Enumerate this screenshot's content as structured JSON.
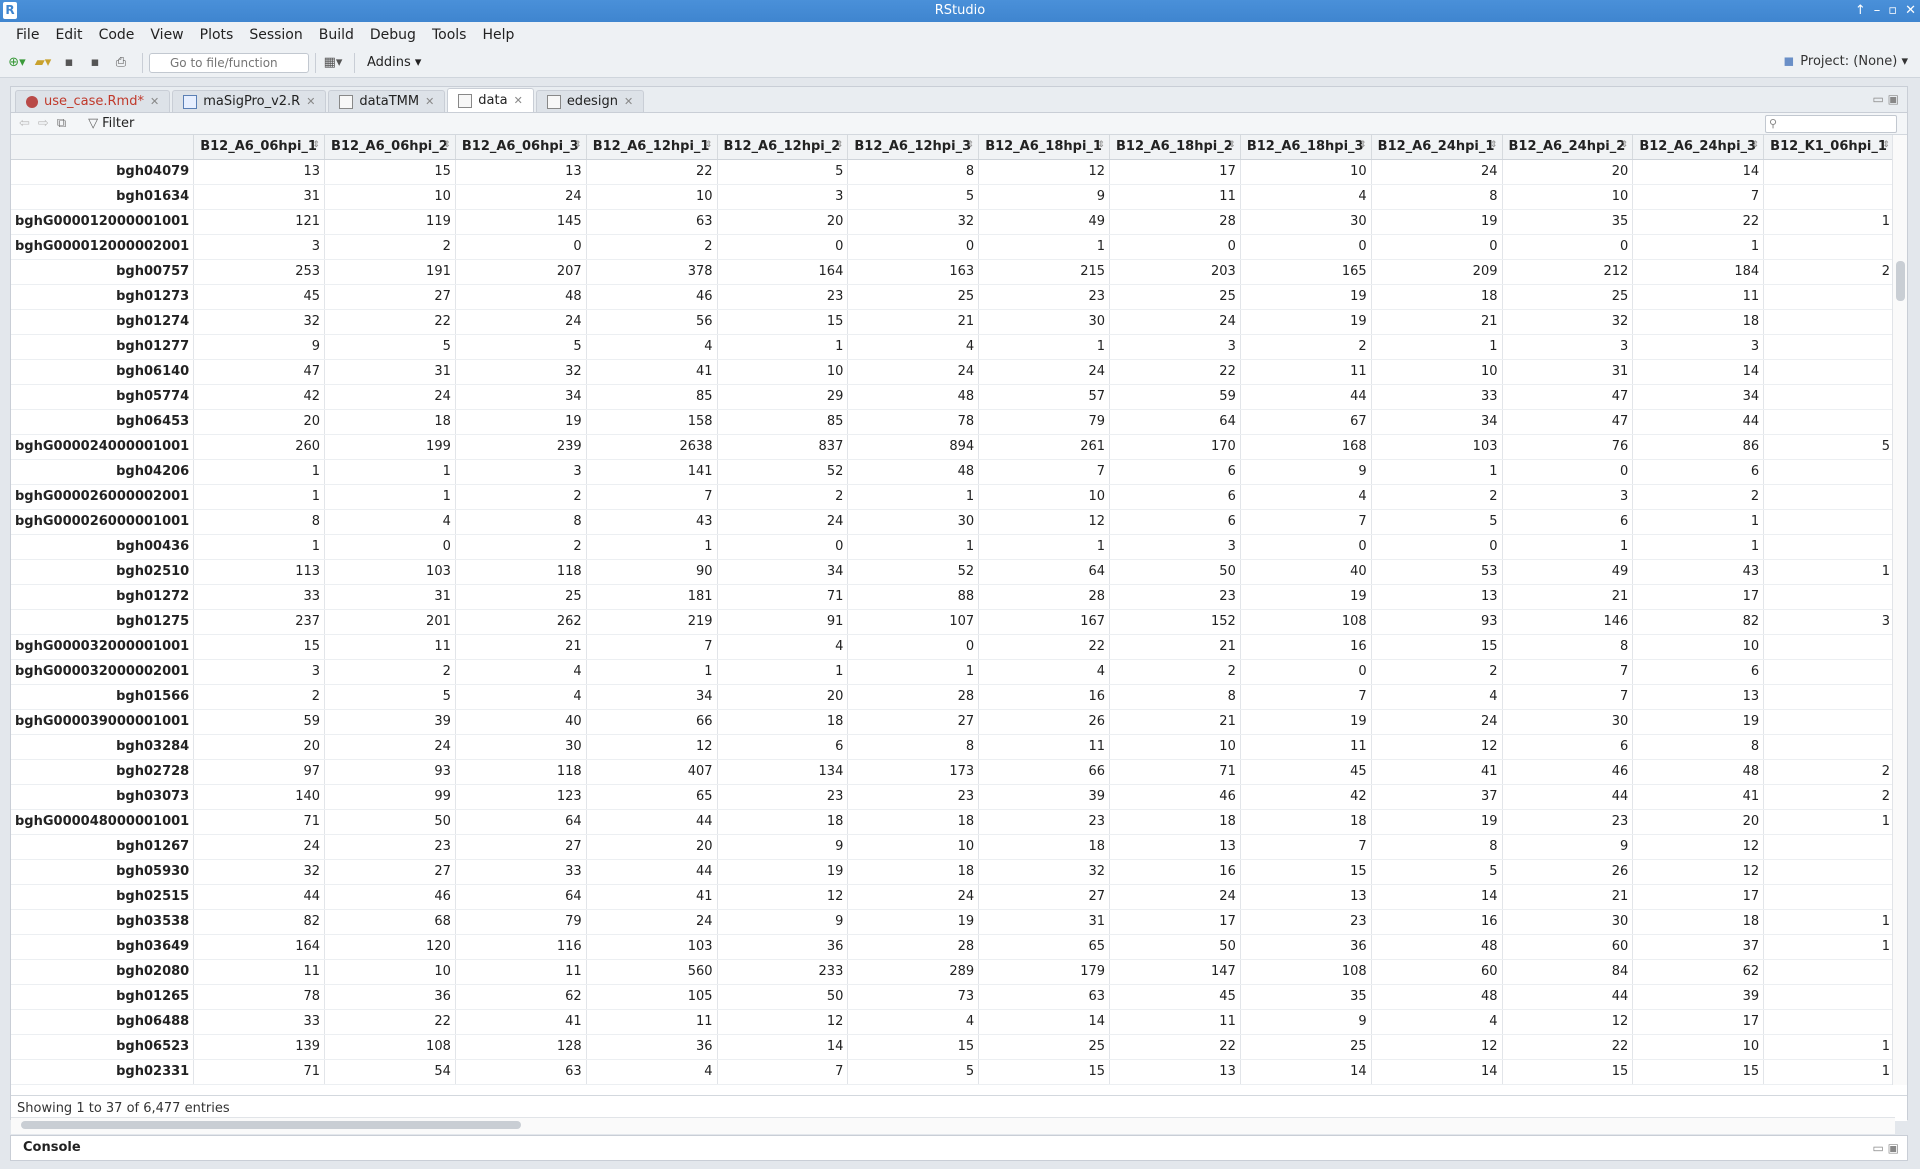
{
  "window": {
    "title": "RStudio"
  },
  "menu": [
    "File",
    "Edit",
    "Code",
    "View",
    "Plots",
    "Session",
    "Build",
    "Debug",
    "Tools",
    "Help"
  ],
  "toolbar": {
    "goto_placeholder": "Go to file/function",
    "addins_label": "Addins ▾",
    "project_label": "Project: (None) ▾"
  },
  "tabs": [
    {
      "label": "use_case.Rmd*",
      "kind": "rmd",
      "modified": true
    },
    {
      "label": "maSigPro_v2.R",
      "kind": "rscript"
    },
    {
      "label": "dataTMM",
      "kind": "data"
    },
    {
      "label": "data",
      "kind": "data",
      "active": true
    },
    {
      "label": "edesign",
      "kind": "data"
    }
  ],
  "filter_label": "Filter",
  "status_text": "Showing 1 to 37 of 6,477 entries",
  "console_label": "Console",
  "table": {
    "columns": [
      "B12_A6_06hpi_1",
      "B12_A6_06hpi_2",
      "B12_A6_06hpi_3",
      "B12_A6_12hpi_1",
      "B12_A6_12hpi_2",
      "B12_A6_12hpi_3",
      "B12_A6_18hpi_1",
      "B12_A6_18hpi_2",
      "B12_A6_18hpi_3",
      "B12_A6_24hpi_1",
      "B12_A6_24hpi_2",
      "B12_A6_24hpi_3",
      "B12_K1_06hpi_1"
    ],
    "rows": [
      [
        "bgh04079",
        "13",
        "15",
        "13",
        "22",
        "5",
        "8",
        "12",
        "17",
        "10",
        "24",
        "20",
        "14",
        ""
      ],
      [
        "bgh01634",
        "31",
        "10",
        "24",
        "10",
        "3",
        "5",
        "9",
        "11",
        "4",
        "8",
        "10",
        "7",
        ""
      ],
      [
        "bghG000012000001001",
        "121",
        "119",
        "145",
        "63",
        "20",
        "32",
        "49",
        "28",
        "30",
        "19",
        "35",
        "22",
        "1"
      ],
      [
        "bghG000012000002001",
        "3",
        "2",
        "0",
        "2",
        "0",
        "0",
        "1",
        "0",
        "0",
        "0",
        "0",
        "1",
        ""
      ],
      [
        "bgh00757",
        "253",
        "191",
        "207",
        "378",
        "164",
        "163",
        "215",
        "203",
        "165",
        "209",
        "212",
        "184",
        "2"
      ],
      [
        "bgh01273",
        "45",
        "27",
        "48",
        "46",
        "23",
        "25",
        "23",
        "25",
        "19",
        "18",
        "25",
        "11",
        ""
      ],
      [
        "bgh01274",
        "32",
        "22",
        "24",
        "56",
        "15",
        "21",
        "30",
        "24",
        "19",
        "21",
        "32",
        "18",
        ""
      ],
      [
        "bgh01277",
        "9",
        "5",
        "5",
        "4",
        "1",
        "4",
        "1",
        "3",
        "2",
        "1",
        "3",
        "3",
        ""
      ],
      [
        "bgh06140",
        "47",
        "31",
        "32",
        "41",
        "10",
        "24",
        "24",
        "22",
        "11",
        "10",
        "31",
        "14",
        ""
      ],
      [
        "bgh05774",
        "42",
        "24",
        "34",
        "85",
        "29",
        "48",
        "57",
        "59",
        "44",
        "33",
        "47",
        "34",
        ""
      ],
      [
        "bgh06453",
        "20",
        "18",
        "19",
        "158",
        "85",
        "78",
        "79",
        "64",
        "67",
        "34",
        "47",
        "44",
        ""
      ],
      [
        "bghG000024000001001",
        "260",
        "199",
        "239",
        "2638",
        "837",
        "894",
        "261",
        "170",
        "168",
        "103",
        "76",
        "86",
        "5"
      ],
      [
        "bgh04206",
        "1",
        "1",
        "3",
        "141",
        "52",
        "48",
        "7",
        "6",
        "9",
        "1",
        "0",
        "6",
        ""
      ],
      [
        "bghG000026000002001",
        "1",
        "1",
        "2",
        "7",
        "2",
        "1",
        "10",
        "6",
        "4",
        "2",
        "3",
        "2",
        ""
      ],
      [
        "bghG000026000001001",
        "8",
        "4",
        "8",
        "43",
        "24",
        "30",
        "12",
        "6",
        "7",
        "5",
        "6",
        "1",
        ""
      ],
      [
        "bgh00436",
        "1",
        "0",
        "2",
        "1",
        "0",
        "1",
        "1",
        "3",
        "0",
        "0",
        "1",
        "1",
        ""
      ],
      [
        "bgh02510",
        "113",
        "103",
        "118",
        "90",
        "34",
        "52",
        "64",
        "50",
        "40",
        "53",
        "49",
        "43",
        "1"
      ],
      [
        "bgh01272",
        "33",
        "31",
        "25",
        "181",
        "71",
        "88",
        "28",
        "23",
        "19",
        "13",
        "21",
        "17",
        ""
      ],
      [
        "bgh01275",
        "237",
        "201",
        "262",
        "219",
        "91",
        "107",
        "167",
        "152",
        "108",
        "93",
        "146",
        "82",
        "3"
      ],
      [
        "bghG000032000001001",
        "15",
        "11",
        "21",
        "7",
        "4",
        "0",
        "22",
        "21",
        "16",
        "15",
        "8",
        "10",
        ""
      ],
      [
        "bghG000032000002001",
        "3",
        "2",
        "4",
        "1",
        "1",
        "1",
        "4",
        "2",
        "0",
        "2",
        "7",
        "6",
        ""
      ],
      [
        "bgh01566",
        "2",
        "5",
        "4",
        "34",
        "20",
        "28",
        "16",
        "8",
        "7",
        "4",
        "7",
        "13",
        ""
      ],
      [
        "bghG000039000001001",
        "59",
        "39",
        "40",
        "66",
        "18",
        "27",
        "26",
        "21",
        "19",
        "24",
        "30",
        "19",
        ""
      ],
      [
        "bgh03284",
        "20",
        "24",
        "30",
        "12",
        "6",
        "8",
        "11",
        "10",
        "11",
        "12",
        "6",
        "8",
        ""
      ],
      [
        "bgh02728",
        "97",
        "93",
        "118",
        "407",
        "134",
        "173",
        "66",
        "71",
        "45",
        "41",
        "46",
        "48",
        "2"
      ],
      [
        "bgh03073",
        "140",
        "99",
        "123",
        "65",
        "23",
        "23",
        "39",
        "46",
        "42",
        "37",
        "44",
        "41",
        "2"
      ],
      [
        "bghG000048000001001",
        "71",
        "50",
        "64",
        "44",
        "18",
        "18",
        "23",
        "18",
        "18",
        "19",
        "23",
        "20",
        "1"
      ],
      [
        "bgh01267",
        "24",
        "23",
        "27",
        "20",
        "9",
        "10",
        "18",
        "13",
        "7",
        "8",
        "9",
        "12",
        ""
      ],
      [
        "bgh05930",
        "32",
        "27",
        "33",
        "44",
        "19",
        "18",
        "32",
        "16",
        "15",
        "5",
        "26",
        "12",
        ""
      ],
      [
        "bgh02515",
        "44",
        "46",
        "64",
        "41",
        "12",
        "24",
        "27",
        "24",
        "13",
        "14",
        "21",
        "17",
        ""
      ],
      [
        "bgh03538",
        "82",
        "68",
        "79",
        "24",
        "9",
        "19",
        "31",
        "17",
        "23",
        "16",
        "30",
        "18",
        "1"
      ],
      [
        "bgh03649",
        "164",
        "120",
        "116",
        "103",
        "36",
        "28",
        "65",
        "50",
        "36",
        "48",
        "60",
        "37",
        "1"
      ],
      [
        "bgh02080",
        "11",
        "10",
        "11",
        "560",
        "233",
        "289",
        "179",
        "147",
        "108",
        "60",
        "84",
        "62",
        ""
      ],
      [
        "bgh01265",
        "78",
        "36",
        "62",
        "105",
        "50",
        "73",
        "63",
        "45",
        "35",
        "48",
        "44",
        "39",
        ""
      ],
      [
        "bgh06488",
        "33",
        "22",
        "41",
        "11",
        "12",
        "4",
        "14",
        "11",
        "9",
        "4",
        "12",
        "17",
        ""
      ],
      [
        "bgh06523",
        "139",
        "108",
        "128",
        "36",
        "14",
        "15",
        "25",
        "22",
        "25",
        "12",
        "22",
        "10",
        "1"
      ],
      [
        "bgh02331",
        "71",
        "54",
        "63",
        "4",
        "7",
        "5",
        "15",
        "13",
        "14",
        "14",
        "15",
        "15",
        "1"
      ]
    ]
  }
}
